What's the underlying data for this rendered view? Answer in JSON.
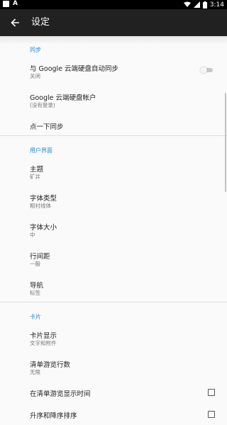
{
  "status_bar": {
    "time": "3:14",
    "icons": [
      "picture-icon",
      "a-icon",
      "wifi-icon",
      "signal-icon",
      "battery-icon"
    ]
  },
  "app_bar": {
    "title": "设定",
    "back_icon": "arrow-left-icon"
  },
  "sections": {
    "sync": {
      "header": "同步",
      "auto_sync_title": "与 Google 云端硬盘自动同步",
      "auto_sync_summary": "关闭",
      "auto_sync_on": false,
      "drive_account_title": "Google 云端硬盘帐户",
      "drive_account_summary": "(没有登录)",
      "sync_once_title": "点一下同步"
    },
    "ui": {
      "header": "用户界面",
      "theme_title": "主题",
      "theme_summary": "矿井",
      "font_type_title": "字体类型",
      "font_type_summary": "粗衬线体",
      "font_size_title": "字体大小",
      "font_size_summary": "中",
      "line_spacing_title": "行间距",
      "line_spacing_summary": "一般",
      "navigation_title": "导航",
      "navigation_summary": "标签"
    },
    "cards": {
      "header": "卡片",
      "card_display_title": "卡片显示",
      "card_display_summary": "文字和附件",
      "list_rows_title": "清单游览行数",
      "list_rows_summary": "无限",
      "show_time_title": "在清单游览显示时间",
      "show_time_checked": false,
      "sort_order_title": "升序和降序排序",
      "sort_order_checked": false
    }
  },
  "colors": {
    "app_bar": "#212121",
    "accent": "#1e88e5",
    "background": "#fafafa"
  }
}
